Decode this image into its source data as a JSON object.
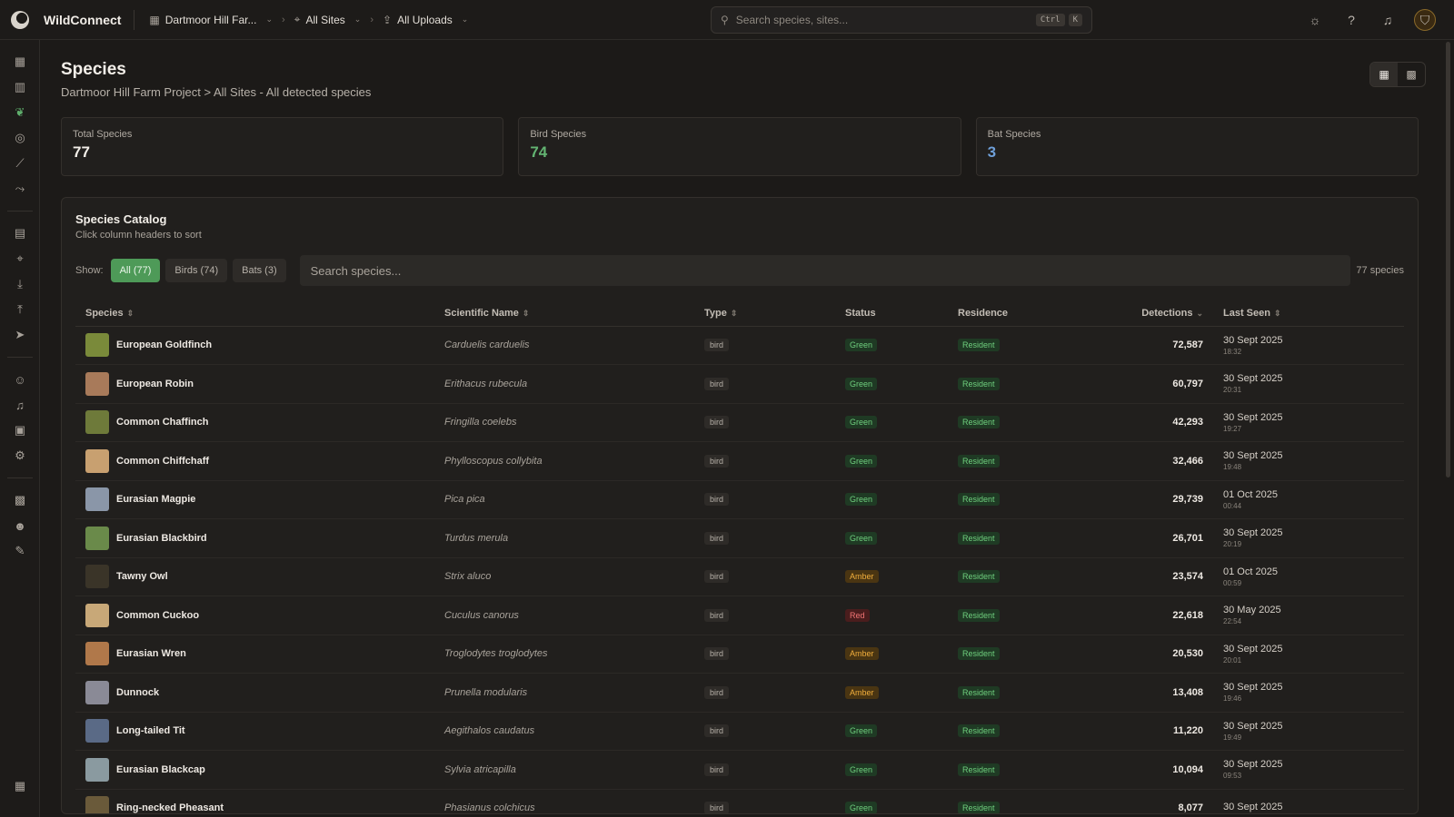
{
  "app": {
    "name": "WildConnect"
  },
  "topbar": {
    "project": "Dartmoor Hill Far...",
    "sites": "All Sites",
    "uploads": "All Uploads",
    "search_placeholder": "Search species, sites...",
    "kbd1": "Ctrl",
    "kbd2": "K"
  },
  "page": {
    "title": "Species",
    "breadcrumb_project": "Dartmoor Hill Farm Project",
    "breadcrumb_sep": ">",
    "breadcrumb_rest": "All Sites - All detected species"
  },
  "stats": [
    {
      "label": "Total Species",
      "value": "77"
    },
    {
      "label": "Bird Species",
      "value": "74"
    },
    {
      "label": "Bat Species",
      "value": "3"
    }
  ],
  "catalog": {
    "title": "Species Catalog",
    "subtitle": "Click column headers to sort",
    "show_label": "Show:",
    "filters": [
      "All (77)",
      "Birds (74)",
      "Bats (3)"
    ],
    "search_placeholder": "Search species...",
    "count": "77 species",
    "columns": [
      "Species",
      "Scientific Name",
      "Type",
      "Status",
      "Residence",
      "Detections",
      "Last Seen"
    ],
    "rows": [
      {
        "name": "European Goldfinch",
        "sci": "Carduelis carduelis",
        "type": "bird",
        "status": "Green",
        "res": "Resident",
        "det": "72,587",
        "date": "30 Sept 2025",
        "time": "18:32",
        "thumb": "#7a8a3a"
      },
      {
        "name": "European Robin",
        "sci": "Erithacus rubecula",
        "type": "bird",
        "status": "Green",
        "res": "Resident",
        "det": "60,797",
        "date": "30 Sept 2025",
        "time": "20:31",
        "thumb": "#a87a5a"
      },
      {
        "name": "Common Chaffinch",
        "sci": "Fringilla coelebs",
        "type": "bird",
        "status": "Green",
        "res": "Resident",
        "det": "42,293",
        "date": "30 Sept 2025",
        "time": "19:27",
        "thumb": "#6e7a3a"
      },
      {
        "name": "Common Chiffchaff",
        "sci": "Phylloscopus collybita",
        "type": "bird",
        "status": "Green",
        "res": "Resident",
        "det": "32,466",
        "date": "30 Sept 2025",
        "time": "19:48",
        "thumb": "#c8a070"
      },
      {
        "name": "Eurasian Magpie",
        "sci": "Pica pica",
        "type": "bird",
        "status": "Green",
        "res": "Resident",
        "det": "29,739",
        "date": "01 Oct 2025",
        "time": "00:44",
        "thumb": "#8a96a8"
      },
      {
        "name": "Eurasian Blackbird",
        "sci": "Turdus merula",
        "type": "bird",
        "status": "Green",
        "res": "Resident",
        "det": "26,701",
        "date": "30 Sept 2025",
        "time": "20:19",
        "thumb": "#6a8a4a"
      },
      {
        "name": "Tawny Owl",
        "sci": "Strix aluco",
        "type": "bird",
        "status": "Amber",
        "res": "Resident",
        "det": "23,574",
        "date": "01 Oct 2025",
        "time": "00:59",
        "thumb": "#3a3428"
      },
      {
        "name": "Common Cuckoo",
        "sci": "Cuculus canorus",
        "type": "bird",
        "status": "Red",
        "res": "Resident",
        "det": "22,618",
        "date": "30 May 2025",
        "time": "22:54",
        "thumb": "#c8a878"
      },
      {
        "name": "Eurasian Wren",
        "sci": "Troglodytes troglodytes",
        "type": "bird",
        "status": "Amber",
        "res": "Resident",
        "det": "20,530",
        "date": "30 Sept 2025",
        "time": "20:01",
        "thumb": "#b0784a"
      },
      {
        "name": "Dunnock",
        "sci": "Prunella modularis",
        "type": "bird",
        "status": "Amber",
        "res": "Resident",
        "det": "13,408",
        "date": "30 Sept 2025",
        "time": "19:46",
        "thumb": "#8a8a96"
      },
      {
        "name": "Long-tailed Tit",
        "sci": "Aegithalos caudatus",
        "type": "bird",
        "status": "Green",
        "res": "Resident",
        "det": "11,220",
        "date": "30 Sept 2025",
        "time": "19:49",
        "thumb": "#5a6a86"
      },
      {
        "name": "Eurasian Blackcap",
        "sci": "Sylvia atricapilla",
        "type": "bird",
        "status": "Green",
        "res": "Resident",
        "det": "10,094",
        "date": "30 Sept 2025",
        "time": "09:53",
        "thumb": "#8a9aa0"
      },
      {
        "name": "Ring-necked Pheasant",
        "sci": "Phasianus colchicus",
        "type": "bird",
        "status": "Green",
        "res": "Resident",
        "det": "8,077",
        "date": "30 Sept 2025",
        "time": "",
        "thumb": "#6a5a3a"
      }
    ]
  },
  "icons": {
    "sidebar": [
      "dashboard-icon",
      "bar-chart-icon",
      "leaf-icon",
      "globe-icon",
      "line-chart-icon",
      "route-icon",
      "file-icon",
      "map-pin-icon",
      "download-icon",
      "upload-icon",
      "send-icon",
      "users-icon",
      "bell-icon",
      "clipboard-icon",
      "gear-icon",
      "building-icon",
      "team-icon",
      "feather-icon",
      "calendar-icon"
    ]
  }
}
